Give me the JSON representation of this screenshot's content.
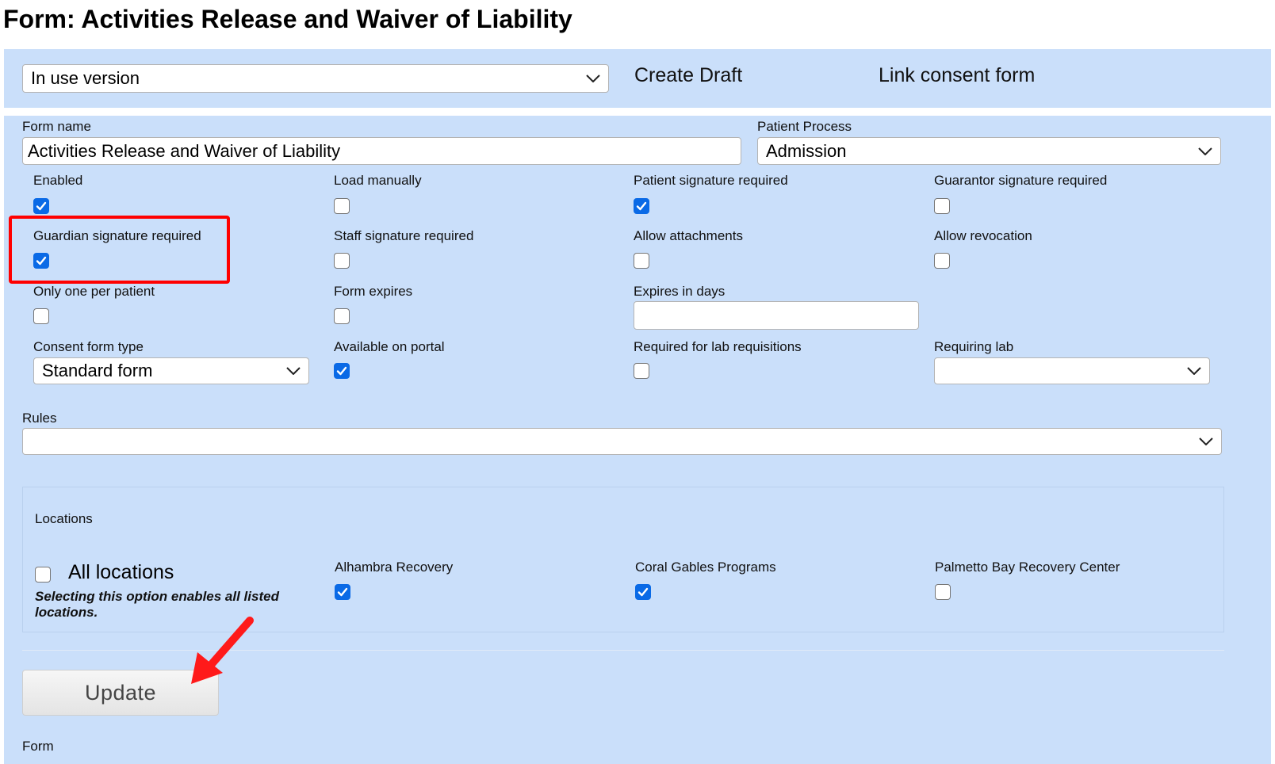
{
  "page": {
    "title": "Form: Activities Release and Waiver of Liability"
  },
  "toolbar": {
    "version_select_value": "In use version",
    "create_draft": "Create Draft",
    "link_consent_form": "Link consent form"
  },
  "form": {
    "form_name_label": "Form name",
    "form_name_value": "Activities Release and Waiver of Liability",
    "patient_process_label": "Patient Process",
    "patient_process_value": "Admission",
    "options": [
      {
        "label": "Enabled",
        "checked": true
      },
      {
        "label": "Load manually",
        "checked": false
      },
      {
        "label": "Patient signature required",
        "checked": true
      },
      {
        "label": "Guarantor signature required",
        "checked": false
      },
      {
        "label": "Guardian signature required",
        "checked": true
      },
      {
        "label": "Staff signature required",
        "checked": false
      },
      {
        "label": "Allow attachments",
        "checked": false
      },
      {
        "label": "Allow revocation",
        "checked": false
      },
      {
        "label": "Only one per patient",
        "checked": false
      },
      {
        "label": "Form expires",
        "checked": false
      },
      {
        "label": "Available on portal",
        "checked": true
      },
      {
        "label": "Required for lab requisitions",
        "checked": false
      }
    ],
    "expires_in_days_label": "Expires in days",
    "expires_in_days_value": "",
    "consent_form_type_label": "Consent form type",
    "consent_form_type_value": "Standard form",
    "requiring_lab_label": "Requiring lab",
    "requiring_lab_value": "",
    "rules_label": "Rules",
    "rules_value": ""
  },
  "locations": {
    "heading": "Locations",
    "all_locations_label": "All locations",
    "all_locations_checked": false,
    "all_locations_hint": "Selecting this option enables all listed locations.",
    "items": [
      {
        "label": "Alhambra Recovery",
        "checked": true
      },
      {
        "label": "Coral Gables Programs",
        "checked": true
      },
      {
        "label": "Palmetto Bay Recovery Center",
        "checked": false
      }
    ]
  },
  "actions": {
    "update": "Update"
  },
  "footer": {
    "partial_label": "Form"
  },
  "annotations": {
    "highlight_color": "#ff0000",
    "arrow_color": "#ff1a1a"
  },
  "colors": {
    "panel_bg": "#cadffa",
    "checkbox_blue": "#0a6ae6"
  }
}
